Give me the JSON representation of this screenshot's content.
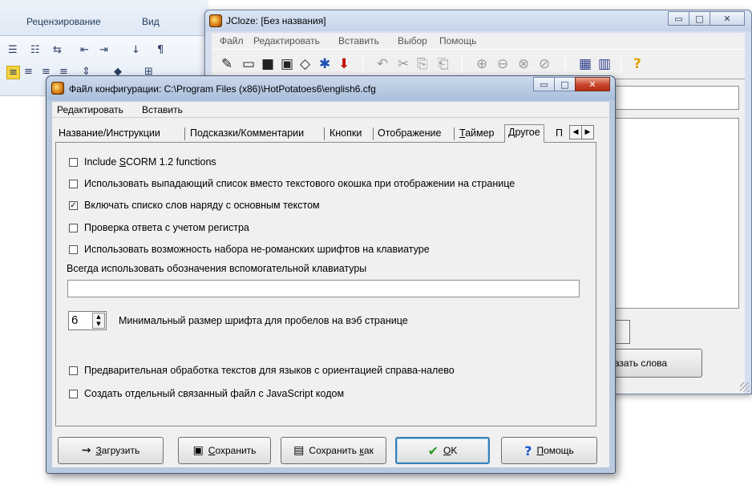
{
  "word": {
    "tabs": [
      "Рецензирование",
      "Вид"
    ],
    "toolbar_glyphs": [
      "☰",
      "☷",
      "⇆",
      "⇤",
      "⇥",
      "↓",
      "¶",
      "≡",
      "≡",
      "≡",
      "≡",
      "⇕",
      "◆",
      "⊞"
    ]
  },
  "jcloze": {
    "title": "JCloze: [Без названия]",
    "window_buttons": [
      "▭",
      "□",
      "✕"
    ],
    "menu": [
      "Файл",
      "Редактировать",
      "Вставить",
      "Выбор",
      "Помощь"
    ],
    "toolbar_glyphs": [
      "✎",
      "▭",
      "■",
      "▣",
      "◇",
      "✱",
      "⬇",
      "↶",
      "✂",
      "⎘",
      "⎗",
      "⊕",
      "⊖",
      "⊗",
      "⊘",
      "▦",
      "▥",
      "?"
    ],
    "show_words_button": "Показать слова"
  },
  "config": {
    "title": "Файл конфигурации: C:\\Program Files (x86)\\HotPotatoes6\\english6.cfg",
    "window_buttons": [
      "▭",
      "□",
      "✕"
    ],
    "menu": [
      "Редактировать",
      "Вставить"
    ],
    "tabs": [
      "Название/Инструкции",
      "Подсказки/Комментарии",
      "Кнопки",
      "Отображение",
      "Таймер",
      "Другое",
      "П"
    ],
    "active_tab": "Другое",
    "tab_scroll": [
      "◀",
      "▶"
    ],
    "options": [
      {
        "label": "Include SCORM 1.2 functions",
        "checked": false
      },
      {
        "label": "Использовать выпадающий список вместо текстового окошка при отображении на странице",
        "checked": false
      },
      {
        "label": "Включать списко слов наряду с основным текстом",
        "checked": true
      },
      {
        "label": "Проверка ответа с учетом регистра",
        "checked": false
      },
      {
        "label": "Использовать возможность набора не-романских шрифтов на клавиатуре",
        "checked": false
      }
    ],
    "keyboard_label": "Всегда использовать обозначения вспомогательной клавиатуры",
    "keyboard_value": "",
    "font_size": {
      "value": "6",
      "label": "Минимальный размер шрифта для пробелов на вэб странице"
    },
    "options_bottom": [
      {
        "label": "Предварительная обработка текстов для языков с ориентацией справа-налево",
        "checked": false
      },
      {
        "label": "Создать отдельный связанный файл с JavaScript кодом",
        "checked": false
      }
    ],
    "buttons": {
      "load": "Загрузить",
      "save": "Сохранить",
      "save_as": "Сохранить как",
      "ok": "OK",
      "help": "Помощь"
    },
    "icons": {
      "check_mark": "✓",
      "unchecked": "",
      "spin_up": "▲",
      "spin_down": "▼",
      "ok_icon": "✔",
      "help_icon": "?",
      "load_icon": "⇝",
      "save_icon": "▣",
      "save_as_icon": "▤"
    },
    "colors": {
      "ok_check": "#2a9a2a",
      "help_question": "#1a56c8"
    }
  }
}
